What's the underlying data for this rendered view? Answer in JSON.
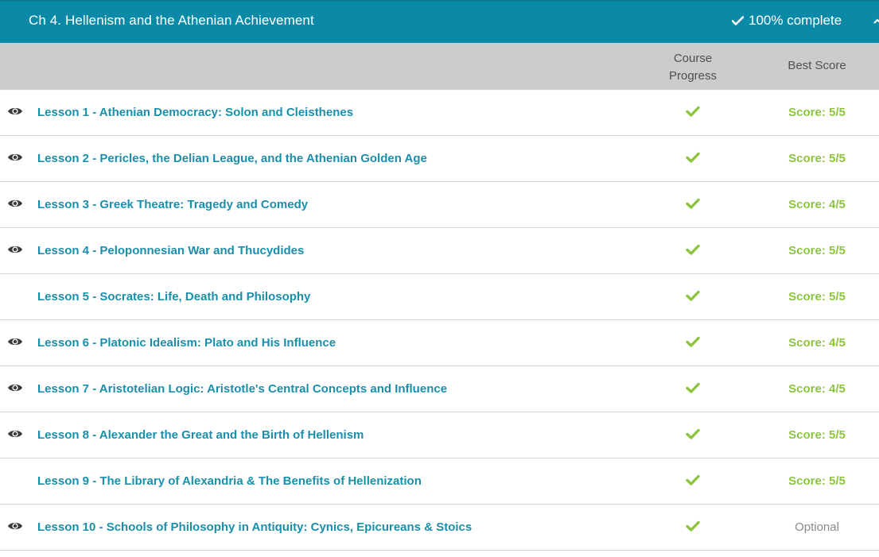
{
  "chapter": {
    "title": "Ch 4. Hellenism and the Athenian Achievement",
    "status": "100% complete"
  },
  "columns": {
    "progress_line1": "Course",
    "progress_line2": "Progress",
    "best_score": "Best Score"
  },
  "colors": {
    "header_bg": "#0b8aa7",
    "link": "#1a8fab",
    "check": "#8dc43f",
    "score": "#8dc43f",
    "optional": "#8a8a8a"
  },
  "lessons": [
    {
      "title": "Lesson 1 - Athenian Democracy: Solon and Cleisthenes",
      "viewed": true,
      "completed": true,
      "score": "Score: 5/5"
    },
    {
      "title": "Lesson 2 - Pericles, the Delian League, and the Athenian Golden Age",
      "viewed": true,
      "completed": true,
      "score": "Score: 5/5"
    },
    {
      "title": "Lesson 3 - Greek Theatre: Tragedy and Comedy",
      "viewed": true,
      "completed": true,
      "score": "Score: 4/5"
    },
    {
      "title": "Lesson 4 - Peloponnesian War and Thucydides",
      "viewed": true,
      "completed": true,
      "score": "Score: 5/5"
    },
    {
      "title": "Lesson 5 - Socrates: Life, Death and Philosophy",
      "viewed": false,
      "completed": true,
      "score": "Score: 5/5"
    },
    {
      "title": "Lesson 6 - Platonic Idealism: Plato and His Influence",
      "viewed": true,
      "completed": true,
      "score": "Score: 4/5"
    },
    {
      "title": "Lesson 7 - Aristotelian Logic: Aristotle's Central Concepts and Influence",
      "viewed": true,
      "completed": true,
      "score": "Score: 4/5"
    },
    {
      "title": "Lesson 8 - Alexander the Great and the Birth of Hellenism",
      "viewed": true,
      "completed": true,
      "score": "Score: 5/5"
    },
    {
      "title": "Lesson 9 - The Library of Alexandria & The Benefits of Hellenization",
      "viewed": false,
      "completed": true,
      "score": "Score: 5/5"
    },
    {
      "title": "Lesson 10 - Schools of Philosophy in Antiquity: Cynics, Epicureans & Stoics",
      "viewed": true,
      "completed": true,
      "score": "Optional"
    }
  ]
}
